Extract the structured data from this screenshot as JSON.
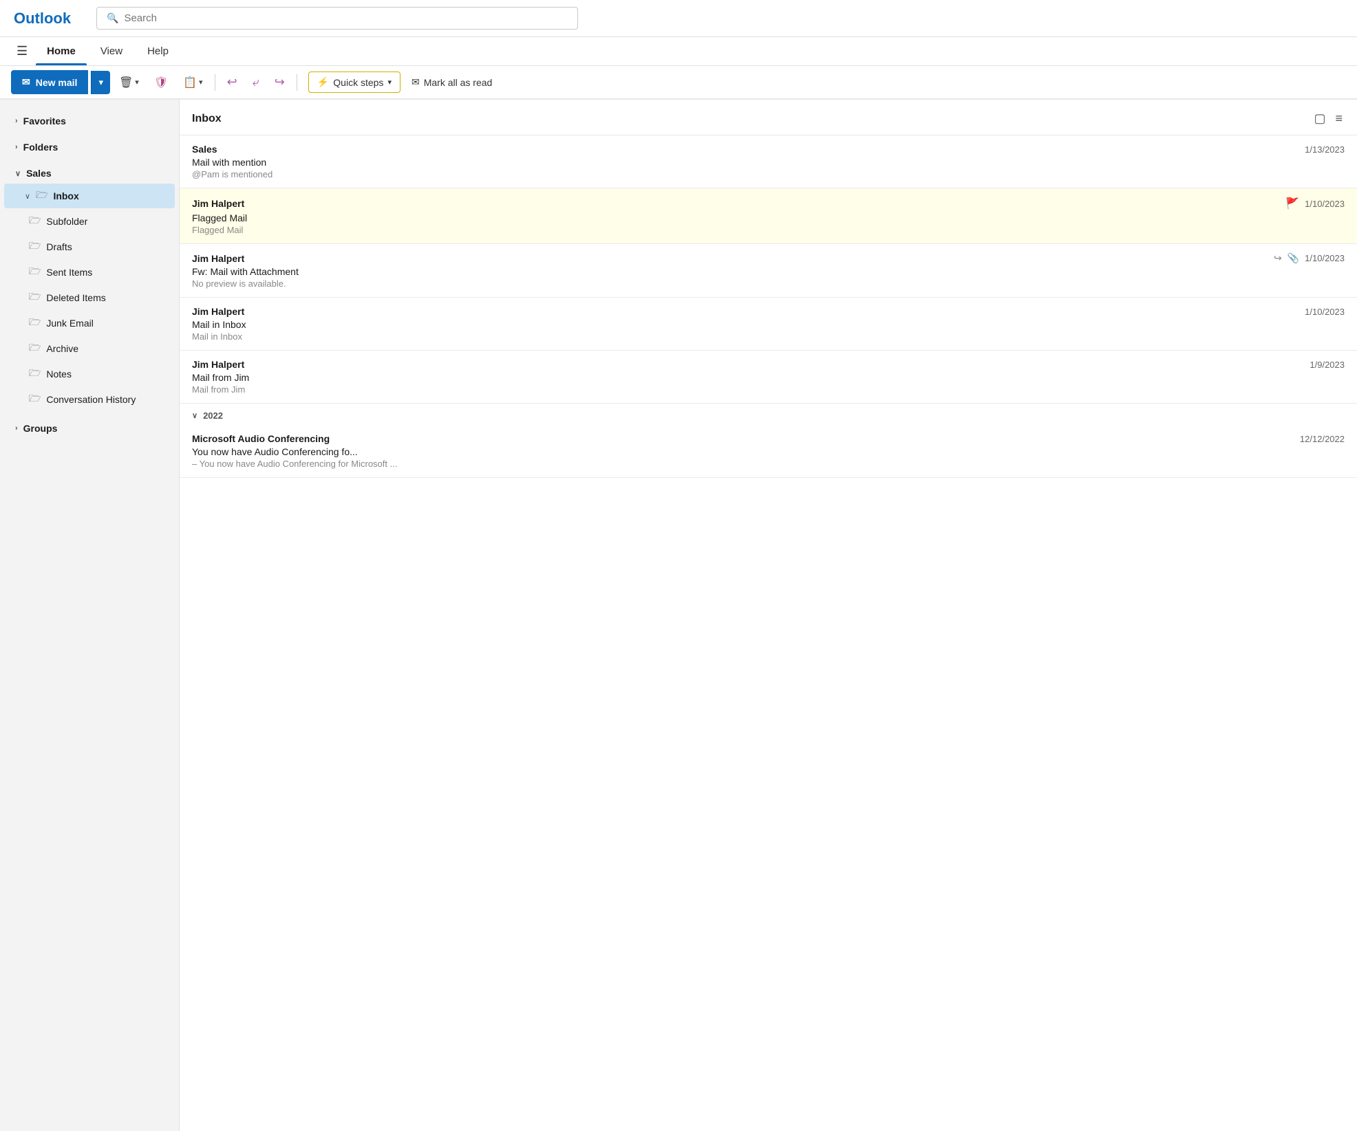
{
  "app": {
    "title": "Outlook"
  },
  "search": {
    "placeholder": "Search"
  },
  "nav": {
    "hamburger": "☰",
    "tabs": [
      {
        "id": "home",
        "label": "Home",
        "active": true
      },
      {
        "id": "view",
        "label": "View",
        "active": false
      },
      {
        "id": "help",
        "label": "Help",
        "active": false
      }
    ]
  },
  "toolbar": {
    "new_mail_label": "New mail",
    "dropdown_arrow": "▾",
    "delete_label": "🗑",
    "delete_dropdown": "▾",
    "report_label": "🛡",
    "move_label": "📋",
    "move_dropdown": "▾",
    "reply_label": "↩",
    "reply_all_label": "↩↩",
    "forward_label": "↪",
    "quick_steps_label": "Quick steps",
    "quick_steps_dropdown": "▾",
    "quick_steps_icon": "⚡",
    "mark_all_read_label": "Mark all as read",
    "mark_all_read_icon": "✉"
  },
  "sidebar": {
    "favorites_label": "Favorites",
    "folders_label": "Folders",
    "sales_label": "Sales",
    "inbox_label": "Inbox",
    "subfolder_label": "Subfolder",
    "drafts_label": "Drafts",
    "sent_items_label": "Sent Items",
    "deleted_items_label": "Deleted Items",
    "junk_email_label": "Junk Email",
    "archive_label": "Archive",
    "notes_label": "Notes",
    "conversation_history_label": "Conversation History",
    "groups_label": "Groups"
  },
  "inbox": {
    "title": "Inbox",
    "emails": [
      {
        "id": 1,
        "sender": "Sales",
        "subject": "Mail with mention",
        "preview": "@Pam is mentioned",
        "date": "1/13/2023",
        "flagged": false,
        "forwarded": false,
        "has_attachment": false
      },
      {
        "id": 2,
        "sender": "Jim Halpert",
        "subject": "Flagged Mail",
        "preview": "Flagged Mail",
        "date": "1/10/2023",
        "flagged": true,
        "forwarded": false,
        "has_attachment": false
      },
      {
        "id": 3,
        "sender": "Jim Halpert",
        "subject": "Fw: Mail with Attachment",
        "preview": "No preview is available.",
        "date": "1/10/2023",
        "flagged": false,
        "forwarded": true,
        "has_attachment": true
      },
      {
        "id": 4,
        "sender": "Jim Halpert",
        "subject": "Mail in Inbox",
        "preview": "Mail in Inbox",
        "date": "1/10/2023",
        "flagged": false,
        "forwarded": false,
        "has_attachment": false
      },
      {
        "id": 5,
        "sender": "Jim Halpert",
        "subject": "Mail from Jim",
        "preview": "Mail from Jim",
        "date": "1/9/2023",
        "flagged": false,
        "forwarded": false,
        "has_attachment": false
      }
    ],
    "group_2022": {
      "label": "2022",
      "chevron": "∨",
      "emails": [
        {
          "id": 6,
          "sender": "Microsoft Audio Conferencing",
          "subject": "You now have Audio Conferencing fo...",
          "preview": "– You now have Audio Conferencing for Microsoft ...",
          "date": "12/12/2022",
          "flagged": false,
          "forwarded": false,
          "has_attachment": false
        }
      ]
    }
  }
}
